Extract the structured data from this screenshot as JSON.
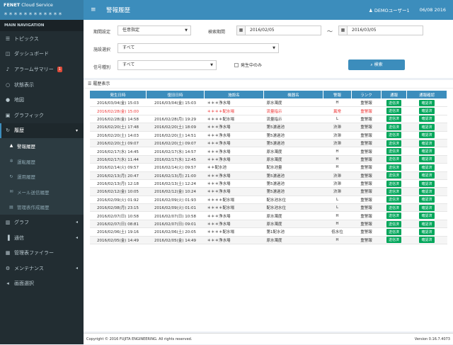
{
  "brand": {
    "title_bold": "FENET",
    "title_rest": " Cloud Service",
    "subtitle": "＊＊＊＊＊＊＊＊＊＊＊＊"
  },
  "nav": {
    "header": "MAIN NAVIGATION",
    "items": [
      {
        "label": "トピックス",
        "icon": "list-icon"
      },
      {
        "label": "ダッシュボード",
        "icon": "dashboard-icon"
      },
      {
        "label": "アラームサマリー",
        "icon": "alarm-icon",
        "badge": "1"
      },
      {
        "label": "状態表示",
        "icon": "status-icon"
      },
      {
        "label": "地図",
        "icon": "map-icon"
      },
      {
        "label": "グラフィック",
        "icon": "graphic-icon"
      },
      {
        "label": "履歴",
        "icon": "history-icon"
      }
    ],
    "subitems": [
      {
        "label": "警報履歴"
      },
      {
        "label": "運転履歴"
      },
      {
        "label": "運用履歴"
      },
      {
        "label": "メール送信履歴"
      },
      {
        "label": "管理表作成履歴"
      }
    ],
    "items2": [
      {
        "label": "グラフ",
        "icon": "chart-icon"
      },
      {
        "label": "通信",
        "icon": "comm-icon"
      },
      {
        "label": "管理表ファイラー",
        "icon": "file-icon"
      },
      {
        "label": "メンテナンス",
        "icon": "gear-icon"
      },
      {
        "label": "画面選択",
        "icon": "screen-icon"
      }
    ]
  },
  "topbar": {
    "title": "警報履歴",
    "user": "DEMOユーザー1",
    "date": "06/08 2016"
  },
  "filters": {
    "period_label": "期間設定",
    "period_value": "任意指定",
    "search_period_label": "検索期間",
    "date_from": "2016/02/05",
    "tilde": "〜",
    "date_to": "2016/03/05",
    "facility_label": "施設選択",
    "facility_value": "すべて",
    "signal_label": "信号種別",
    "signal_value": "すべて",
    "checkbox_label": "発生中のみ",
    "search_button": "検索"
  },
  "history": {
    "title": "履歴表示",
    "columns": [
      "発生日時",
      "復旧日時",
      "施設名",
      "機器名",
      "警報",
      "ランク",
      "通報",
      "通報確認"
    ],
    "rows": [
      [
        "2016/03/04(金) 15:03",
        "2016/03/04(金) 15:03",
        "＊＊＊浄水場",
        "原水濁度",
        "H",
        "重警報",
        "送信済",
        "確認済"
      ],
      [
        "2016/02/28(金) 15:00",
        "",
        "＊＊＊＊配水場",
        "流量指示",
        "異常",
        "重警報",
        "送信済",
        "確認済"
      ],
      [
        "2016/02/28(金) 14:58",
        "2016/02/28(月) 19:29",
        "＊＊＊＊配水場",
        "流量指示",
        "L",
        "重警報",
        "送信済",
        "確認済"
      ],
      [
        "2016/02/20(土) 17:48",
        "2016/02/20(土) 18:09",
        "＊＊＊浄水場",
        "第5濾過池",
        "渋滞",
        "重警報",
        "送信済",
        "確認済"
      ],
      [
        "2016/02/20(土) 14:03",
        "2016/02/20(土) 14:51",
        "＊＊＊浄水場",
        "第5濾過池",
        "渋滞",
        "重警報",
        "送信済",
        "確認済"
      ],
      [
        "2016/02/20(土) 09:07",
        "2016/02/20(土) 09:07",
        "＊＊＊浄水場",
        "第5濾過池",
        "渋滞",
        "重警報",
        "送信済",
        "確認済"
      ],
      [
        "2016/02/17(水) 14:45",
        "2016/02/17(水) 14:57",
        "＊＊＊浄水場",
        "原水濁度",
        "H",
        "重警報",
        "送信済",
        "確認済"
      ],
      [
        "2016/02/17(水) 11:44",
        "2016/02/17(水) 12:45",
        "＊＊＊浄水場",
        "原水濁度",
        "H",
        "重警報",
        "送信済",
        "確認済"
      ],
      [
        "2016/02/14(火) 09:57",
        "2016/02/14(火) 09:57",
        "＊＊配水池",
        "配水池量",
        "H",
        "重警報",
        "送信済",
        "確認済"
      ],
      [
        "2016/02/13(月) 20:47",
        "2016/02/13(月) 21:00",
        "＊＊＊浄水場",
        "第5濾過池",
        "渋滞",
        "重警報",
        "送信済",
        "確認済"
      ],
      [
        "2016/02/13(月) 12:18",
        "2016/02/13(土) 12:24",
        "＊＊＊浄水場",
        "第5濾過池",
        "渋滞",
        "重警報",
        "送信済",
        "確認済"
      ],
      [
        "2016/02/12(金) 10:05",
        "2016/02/12(金) 10:24",
        "＊＊＊浄水場",
        "第5濾過池",
        "渋滞",
        "重警報",
        "送信済",
        "確認済"
      ],
      [
        "2016/02/09(火) 01:92",
        "2016/02/09(火) 01:93",
        "＊＊＊＊配水場",
        "配水池水位",
        "L",
        "重警報",
        "送信済",
        "確認済"
      ],
      [
        "2016/02/08(月) 23:15",
        "2016/02/09(火) 01:01",
        "＊＊＊＊配水場",
        "配水池水位",
        "L",
        "重警報",
        "送信済",
        "確認済"
      ],
      [
        "2016/02/07(日) 10:58",
        "2016/02/07(日) 10:58",
        "＊＊＊浄水場",
        "原水濁度",
        "H",
        "重警報",
        "送信済",
        "確認済"
      ],
      [
        "2016/02/07(日) 08:81",
        "2016/02/07(日) 09:01",
        "＊＊＊浄水場",
        "原水濁度",
        "H",
        "重警報",
        "送信済",
        "確認済"
      ],
      [
        "2016/02/06(土) 19:16",
        "2016/02/06(土) 20:05",
        "＊＊＊＊配水場",
        "第1配水池",
        "低水位",
        "重警報",
        "送信済",
        "確認済"
      ],
      [
        "2016/02/05(金) 14:49",
        "2016/02/05(金) 14:49",
        "＊＊＊浄水場",
        "原水濁度",
        "H",
        "重警報",
        "送信済",
        "確認済"
      ]
    ]
  },
  "footer": {
    "copyright": "Copyright © 2016 FUJITA ENGINEERING. All rights reserved.",
    "version": "Version 0.16.7.4073"
  }
}
